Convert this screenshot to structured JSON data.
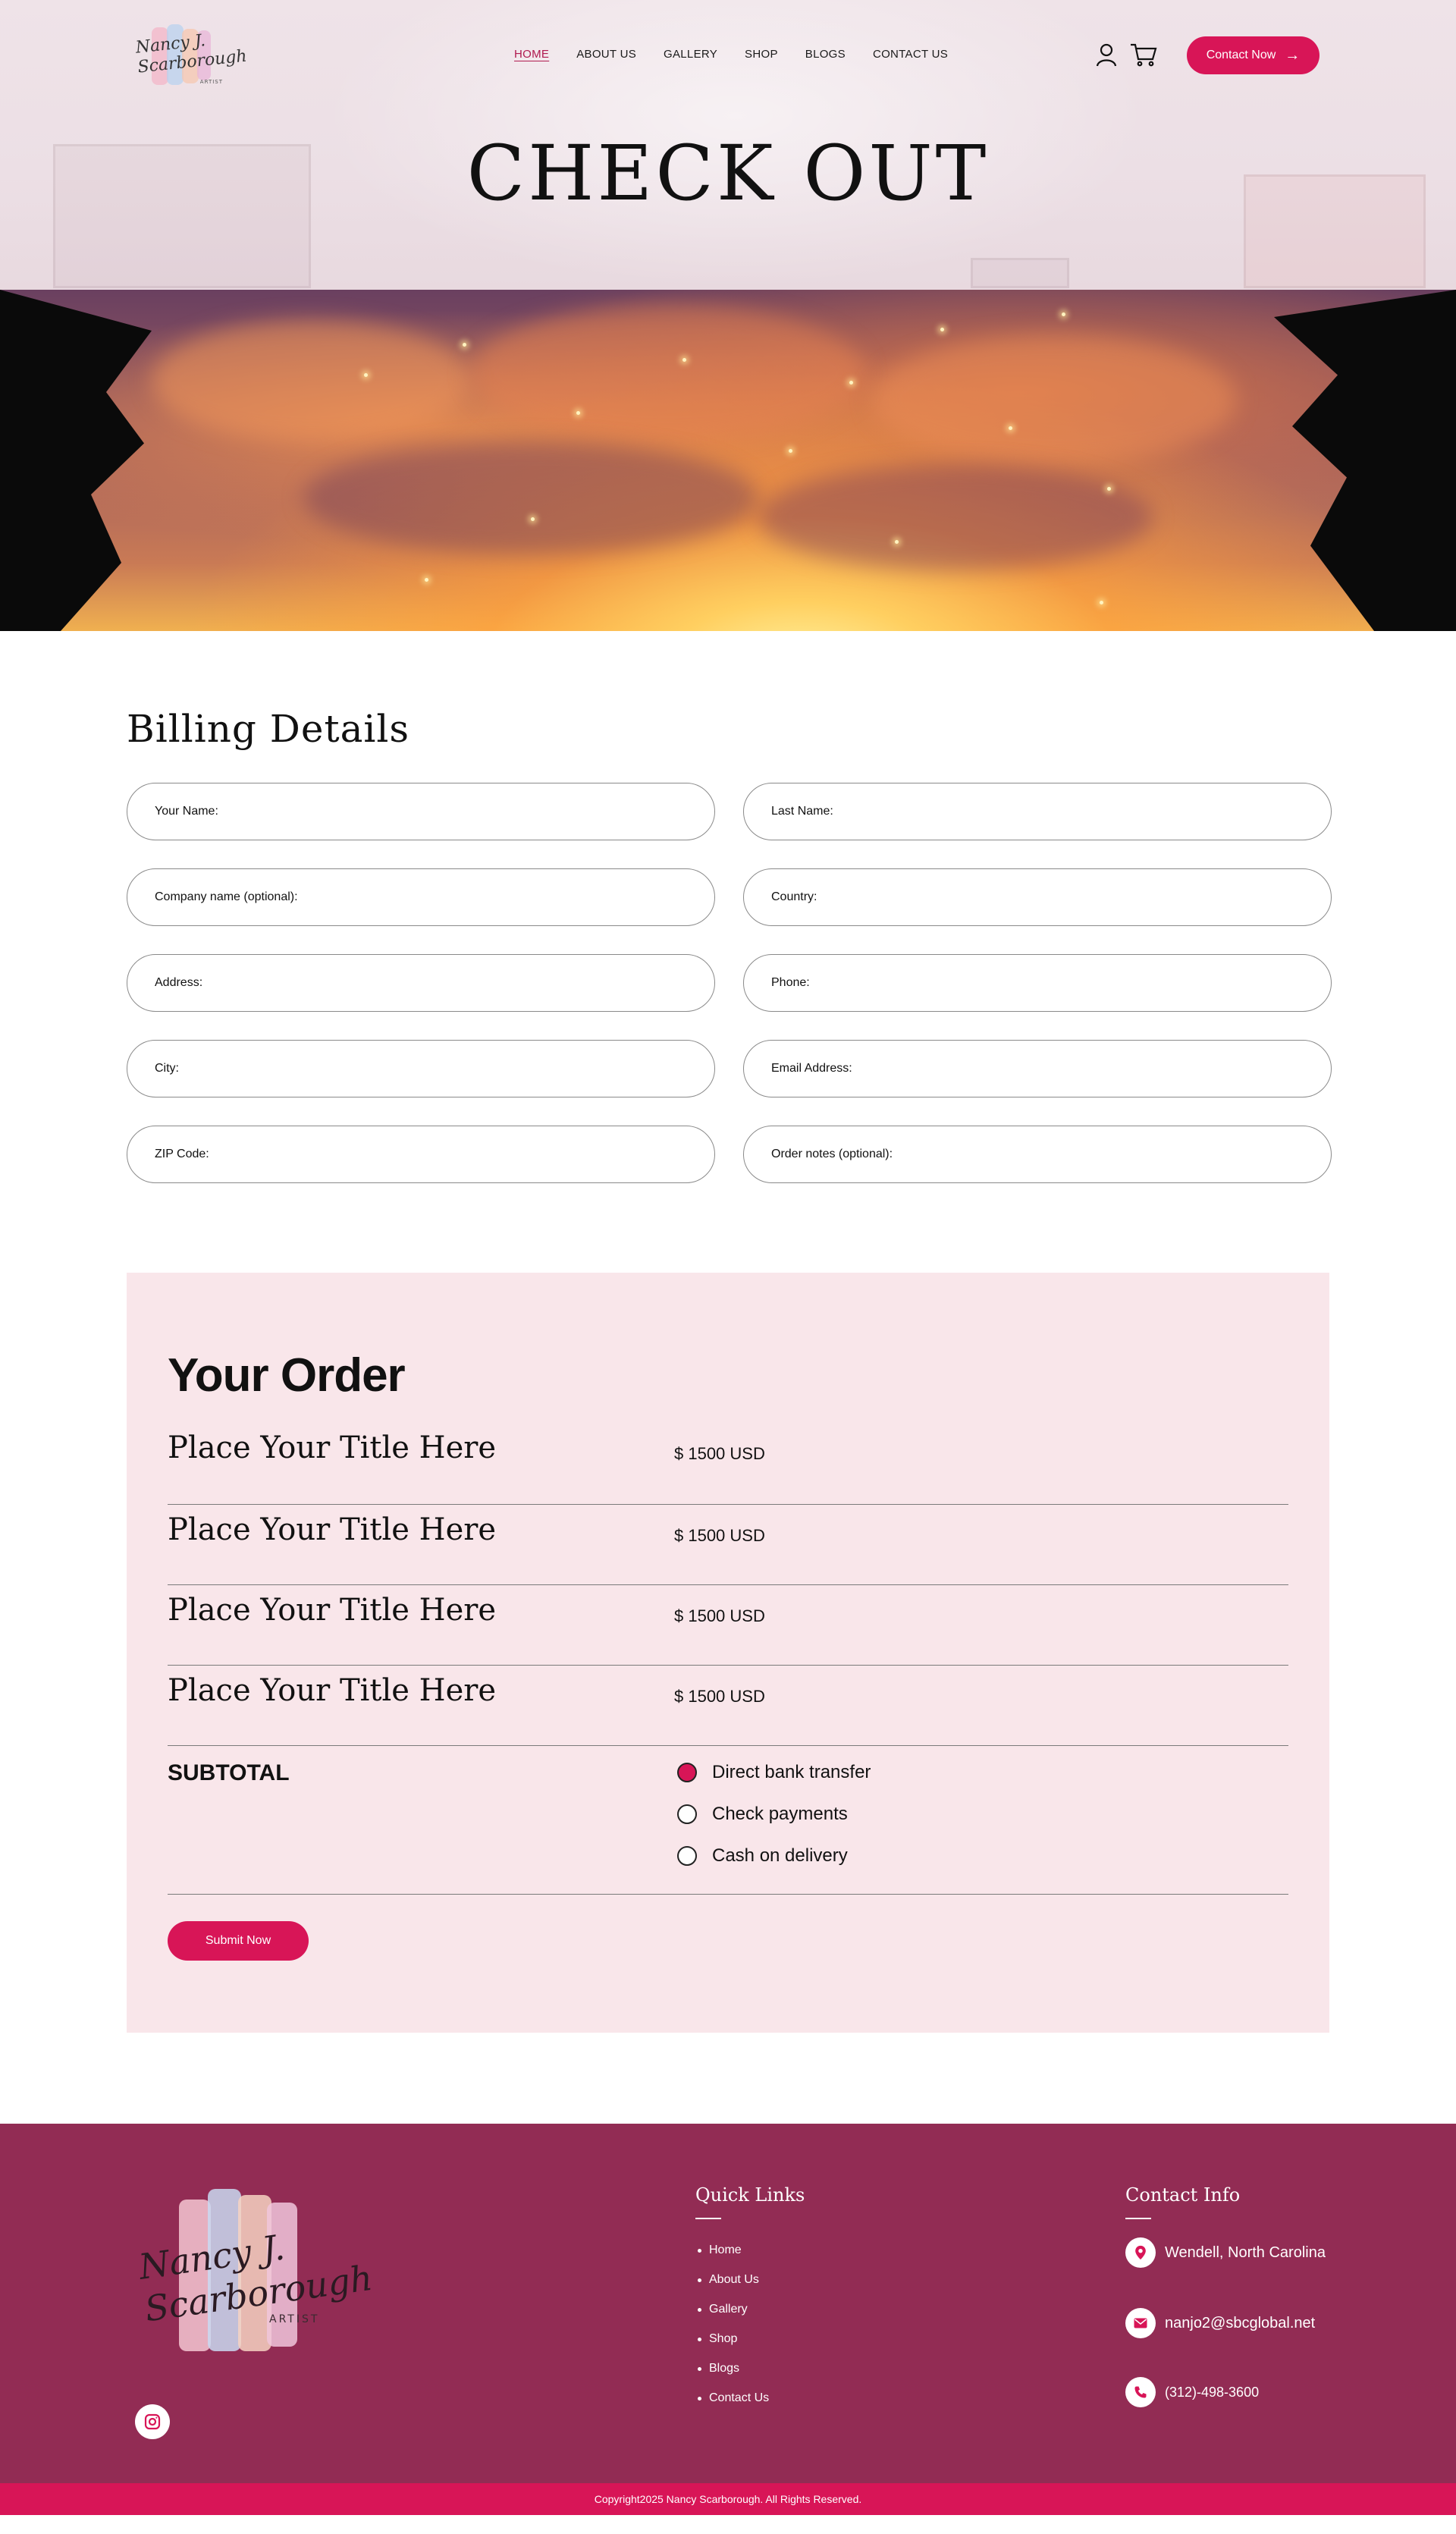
{
  "brand": {
    "logo_script": "Nancy J. Scarborough",
    "logo_tag": "ARTIST"
  },
  "nav": {
    "items": [
      {
        "label": "HOME",
        "active": true
      },
      {
        "label": "ABOUT US",
        "active": false
      },
      {
        "label": "GALLERY",
        "active": false
      },
      {
        "label": "SHOP",
        "active": false
      },
      {
        "label": "BLOGS",
        "active": false
      },
      {
        "label": "CONTACT US",
        "active": false
      }
    ],
    "user_icon": "user-icon",
    "cart_icon": "cart-icon",
    "contact_button": "Contact Now",
    "contact_arrow_icon": "arrow-right-icon"
  },
  "hero": {
    "title": "CHECK OUT"
  },
  "billing": {
    "heading": "Billing Details",
    "fields": [
      {
        "label": "Your Name:"
      },
      {
        "label": "Last Name:"
      },
      {
        "label": "Company name (optional):"
      },
      {
        "label": "Country:"
      },
      {
        "label": "Address:"
      },
      {
        "label": "Phone:"
      },
      {
        "label": "City:"
      },
      {
        "label": "Email Address:"
      },
      {
        "label": "ZIP Code:"
      },
      {
        "label": "Order notes (optional):"
      }
    ]
  },
  "order": {
    "heading": "Your Order",
    "items": [
      {
        "title": "Place Your Title Here",
        "price": "$ 1500 USD"
      },
      {
        "title": "Place Your Title Here",
        "price": "$ 1500 USD"
      },
      {
        "title": "Place Your Title Here",
        "price": "$ 1500 USD"
      },
      {
        "title": "Place Your Title Here",
        "price": "$ 1500 USD"
      }
    ],
    "subtotal_label": "SUBTOTAL",
    "payment_options": [
      {
        "label": "Direct bank transfer",
        "selected": true
      },
      {
        "label": "Check payments",
        "selected": false
      },
      {
        "label": "Cash on delivery",
        "selected": false
      }
    ],
    "submit_label": "Submit Now"
  },
  "footer": {
    "instagram_icon": "instagram-icon",
    "quick_links_title": "Quick Links",
    "quick_links": [
      "Home",
      "About Us",
      "Gallery",
      "Shop",
      "Blogs",
      "Contact Us"
    ],
    "contact_title": "Contact Info",
    "location": "Wendell, North Carolina",
    "email": "nanjo2@sbcglobal.net",
    "phone": "(312)-498-3600",
    "copyright": "Copyright2025 Nancy Scarborough. All Rights Reserved."
  },
  "colors": {
    "accent": "#d81557",
    "footer_bg": "#922c54",
    "order_bg": "#f9e6ea",
    "hero_bg": "#efe3e8",
    "active_nav": "#b01a4f"
  }
}
